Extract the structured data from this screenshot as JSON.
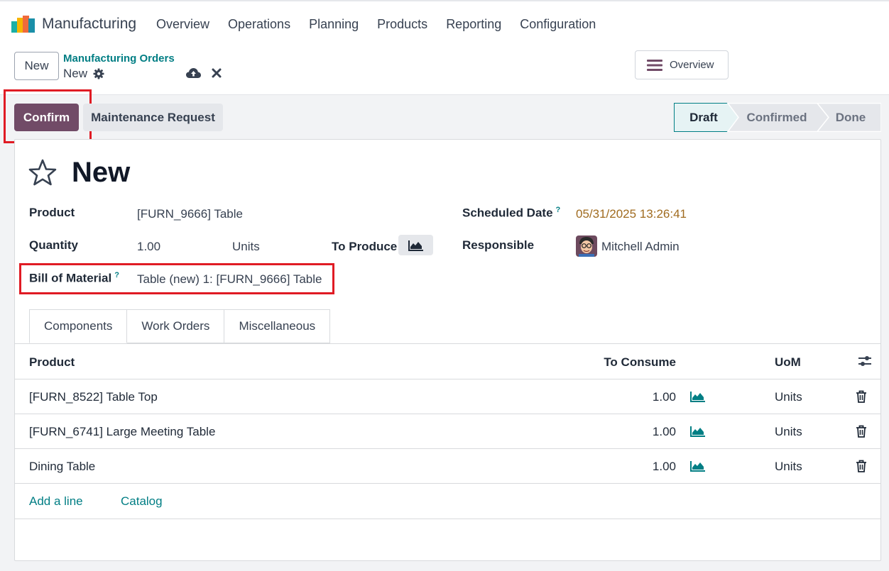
{
  "app": {
    "name": "Manufacturing"
  },
  "nav": [
    "Overview",
    "Operations",
    "Planning",
    "Products",
    "Reporting",
    "Configuration"
  ],
  "control_panel": {
    "new_button": "New",
    "breadcrumb_parent": "Manufacturing Orders",
    "breadcrumb_current": "New",
    "overview_button": "Overview"
  },
  "actions": {
    "confirm": "Confirm",
    "maintenance": "Maintenance Request"
  },
  "status": {
    "steps": [
      "Draft",
      "Confirmed",
      "Done"
    ],
    "active": "Draft"
  },
  "form": {
    "title": "New",
    "product_label": "Product",
    "product_value": "[FURN_9666] Table",
    "quantity_label": "Quantity",
    "quantity_value": "1.00",
    "quantity_uom": "Units",
    "to_produce_label": "To Produce",
    "bom_label": "Bill of Material",
    "bom_help": "?",
    "bom_value": "Table (new) 1: [FURN_9666] Table",
    "scheduled_label": "Scheduled Date",
    "scheduled_help": "?",
    "scheduled_value": "05/31/2025 13:26:41",
    "responsible_label": "Responsible",
    "responsible_value": "Mitchell Admin"
  },
  "tabs": [
    "Components",
    "Work Orders",
    "Miscellaneous"
  ],
  "components": {
    "headers": {
      "product": "Product",
      "to_consume": "To Consume",
      "uom": "UoM"
    },
    "rows": [
      {
        "product": "[FURN_8522] Table Top",
        "to_consume": "1.00",
        "uom": "Units"
      },
      {
        "product": "[FURN_6741] Large Meeting Table",
        "to_consume": "1.00",
        "uom": "Units"
      },
      {
        "product": "Dining Table",
        "to_consume": "1.00",
        "uom": "Units"
      }
    ],
    "add_line": "Add a line",
    "catalog": "Catalog"
  },
  "colors": {
    "primary": "#714b67",
    "link": "#017e84",
    "date": "#a06b1f",
    "highlight": "#e01b24"
  }
}
